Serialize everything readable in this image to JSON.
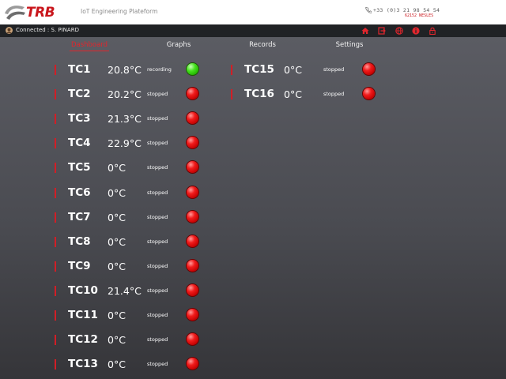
{
  "header": {
    "logo_text": "TRB",
    "platform_title": "IoT Engineering Plateform",
    "phone": "+33 (0)3 21 98 54 54",
    "address": "62152 NESLES",
    "phone_icon": "phone-icon"
  },
  "statusbar": {
    "connected_label": "Connected : S. PINARD",
    "icons": [
      "home-icon",
      "logout-icon",
      "globe-icon",
      "info-icon",
      "lock-icon"
    ]
  },
  "tabs": [
    {
      "label": "Dashboard",
      "active": true
    },
    {
      "label": "Graphs",
      "active": false
    },
    {
      "label": "Records",
      "active": false
    },
    {
      "label": "Settings",
      "active": false
    }
  ],
  "sensors": {
    "col1": [
      {
        "name": "TC1",
        "temp": "20.8°C",
        "status": "recording",
        "recording": true
      },
      {
        "name": "TC2",
        "temp": "20.2°C",
        "status": "stopped",
        "recording": false
      },
      {
        "name": "TC3",
        "temp": "21.3°C",
        "status": "stopped",
        "recording": false
      },
      {
        "name": "TC4",
        "temp": "22.9°C",
        "status": "stopped",
        "recording": false
      },
      {
        "name": "TC5",
        "temp": "0°C",
        "status": "stopped",
        "recording": false
      },
      {
        "name": "TC6",
        "temp": "0°C",
        "status": "stopped",
        "recording": false
      },
      {
        "name": "TC7",
        "temp": "0°C",
        "status": "stopped",
        "recording": false
      },
      {
        "name": "TC8",
        "temp": "0°C",
        "status": "stopped",
        "recording": false
      },
      {
        "name": "TC9",
        "temp": "0°C",
        "status": "stopped",
        "recording": false
      },
      {
        "name": "TC10",
        "temp": "21.4°C",
        "status": "stopped",
        "recording": false
      },
      {
        "name": "TC11",
        "temp": "0°C",
        "status": "stopped",
        "recording": false
      },
      {
        "name": "TC12",
        "temp": "0°C",
        "status": "stopped",
        "recording": false
      },
      {
        "name": "TC13",
        "temp": "0°C",
        "status": "stopped",
        "recording": false
      }
    ],
    "col2": [
      {
        "name": "TC15",
        "temp": "0°C",
        "status": "stopped",
        "recording": false
      },
      {
        "name": "TC16",
        "temp": "0°C",
        "status": "stopped",
        "recording": false
      }
    ]
  },
  "colors": {
    "accent_red": "#d21e26",
    "led_on": "#46e21e",
    "led_off": "#f11c1c",
    "statusbar_bg": "#202225"
  }
}
